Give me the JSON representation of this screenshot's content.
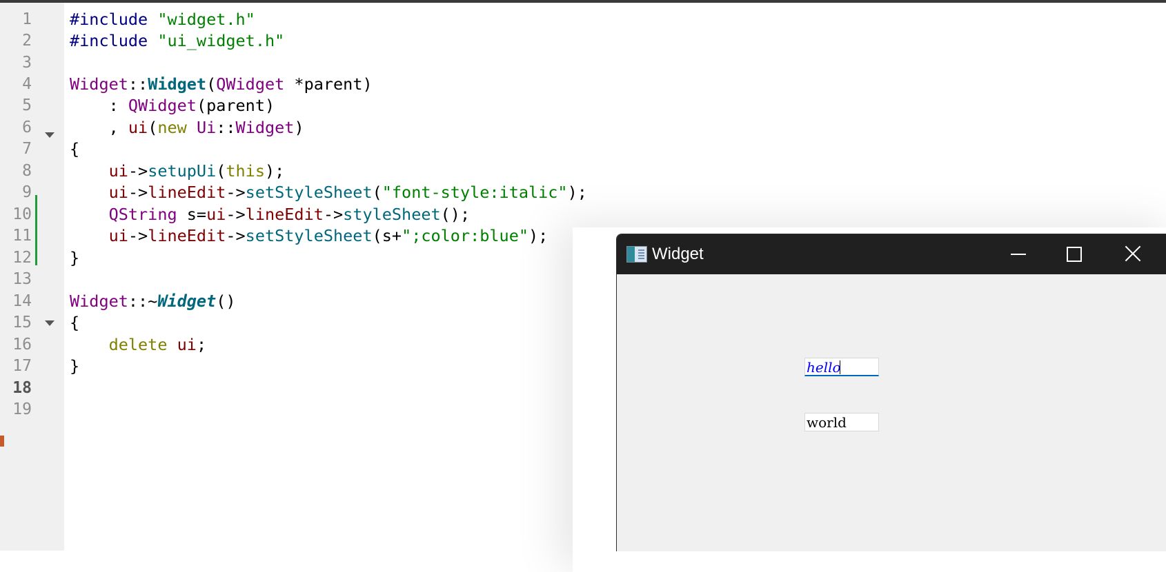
{
  "editor": {
    "line_numbers": [
      "1",
      "2",
      "3",
      "4",
      "5",
      "6",
      "7",
      "8",
      "9",
      "10",
      "11",
      "12",
      "13",
      "14",
      "15",
      "16",
      "17",
      "18",
      "19"
    ],
    "current_line": "18",
    "lines": [
      [
        "#include",
        " ",
        "\"widget.h\""
      ],
      [
        "#include",
        " ",
        "\"ui_widget.h\""
      ],
      [],
      [
        "Widget",
        "::",
        "Widget",
        "(",
        "QWidget",
        " *parent)"
      ],
      [
        "    : ",
        "QWidget",
        "(parent)"
      ],
      [
        "    , ",
        "ui",
        "(",
        "new",
        " ",
        "Ui",
        "::",
        "Widget",
        ")"
      ],
      [
        "{"
      ],
      [
        "    ",
        "ui",
        "->",
        "setupUi",
        "(",
        "this",
        ");"
      ],
      [
        "    ",
        "ui",
        "->",
        "lineEdit",
        "->",
        "setStyleSheet",
        "(",
        "\"font-style:italic\"",
        ");"
      ],
      [
        "    ",
        "QString",
        " s=",
        "ui",
        "->",
        "lineEdit",
        "->",
        "styleSheet",
        "();"
      ],
      [
        "    ",
        "ui",
        "->",
        "lineEdit",
        "->",
        "setStyleSheet",
        "(s+",
        "\";color:blue\"",
        ");"
      ],
      [
        "}"
      ],
      [],
      [
        "Widget",
        "::~",
        "Widget",
        "()"
      ],
      [
        "{"
      ],
      [
        "    ",
        "delete",
        " ",
        "ui",
        ";"
      ],
      [
        "}"
      ],
      [],
      []
    ]
  },
  "window": {
    "title": "Widget",
    "line_edit_1": {
      "value": "hello"
    },
    "line_edit_2": {
      "value": "world"
    }
  },
  "colors": {
    "keyword": "#808000",
    "preprocessor": "#000080",
    "string": "#008000",
    "type": "#800080",
    "function": "#00677c",
    "member": "#800000",
    "changebar": "#1f9b3a",
    "titlebar": "#202020",
    "window_bg": "#f0f0f0"
  }
}
